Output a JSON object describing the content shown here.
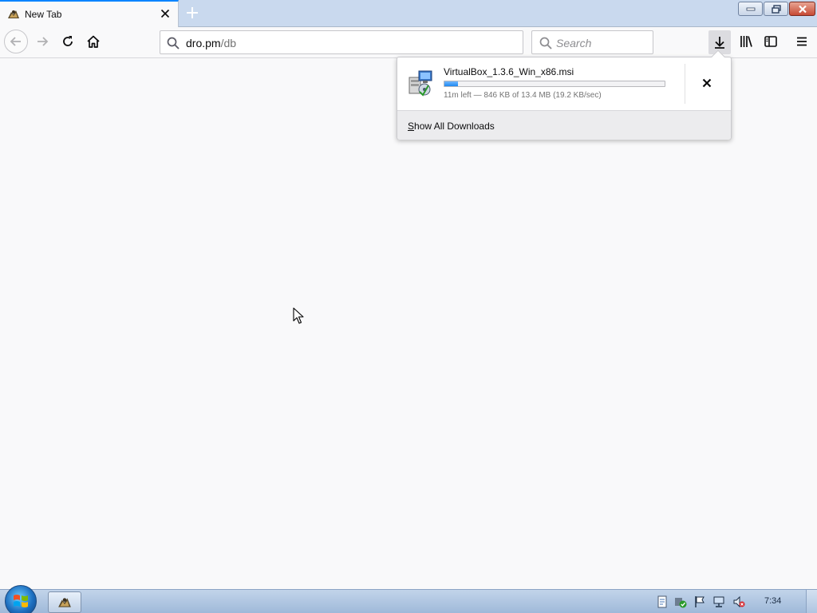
{
  "window": {
    "tab_title": "New Tab",
    "controls": {
      "minimize": "minimize",
      "maximize": "maximize",
      "close": "close"
    }
  },
  "nav": {
    "url_host": "dro.pm",
    "url_path": "/db",
    "search_placeholder": "Search"
  },
  "downloads_panel": {
    "filename": "VirtualBox_1.3.6_Win_x86.msi",
    "status": "11m left — 846 KB of 13.4 MB (19.2 KB/sec)",
    "progress_fraction": 0.063,
    "show_all_accesskey": "S",
    "show_all_rest": "how All Downloads"
  },
  "taskbar": {
    "clock": "7:34"
  },
  "icons": {
    "tab_favicon": "firefox-icon",
    "tab_close": "close-icon",
    "new_tab": "plus-icon",
    "back": "arrow-left-icon",
    "forward": "arrow-right-icon",
    "reload": "reload-icon",
    "home": "home-icon",
    "url_search": "search-icon",
    "downloads": "download-icon",
    "library": "library-icon",
    "sidebar": "sidebar-icon",
    "menu": "hamburger-icon",
    "file": "msi-installer-icon",
    "cancel": "close-icon"
  },
  "colors": {
    "accent": "#0a84ff",
    "progress": "#1e88f0",
    "tabstrip": "#c9d9ee",
    "taskbar": "#a9c0de"
  }
}
